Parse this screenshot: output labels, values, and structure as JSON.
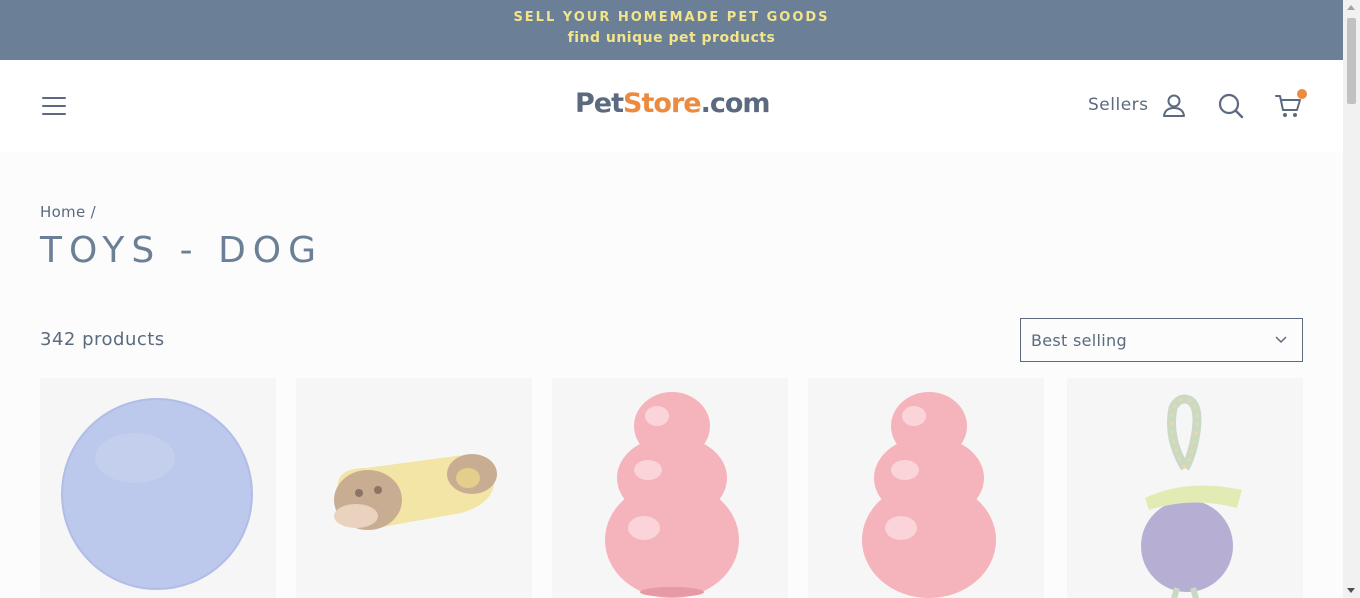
{
  "announcement": {
    "line1": "SELL YOUR HOMEMADE PET GOODS",
    "line2": "find unique pet products"
  },
  "header": {
    "logo_part1": "Pet",
    "logo_part2": "St",
    "logo_part3": "o",
    "logo_part4": "re",
    "logo_part5": ".com",
    "sellers_label": "Sellers",
    "icons": [
      "menu-icon",
      "user-icon",
      "search-icon",
      "cart-icon"
    ]
  },
  "breadcrumb": {
    "home": "Home",
    "separator": "/"
  },
  "page": {
    "title": "TOYS - DOG",
    "product_count": "342 products"
  },
  "sort": {
    "selected": "Best selling"
  },
  "products": [
    {
      "name": "blue-jolly-ball"
    },
    {
      "name": "monkey-plush-toy"
    },
    {
      "name": "red-kong-classic"
    },
    {
      "name": "red-kong-classic-2"
    },
    {
      "name": "purple-rope-ball"
    }
  ],
  "colors": {
    "announcement_bg": "#6b7f96",
    "announcement_text": "#f3e58a",
    "text": "#5b6a7e",
    "accent": "#ec8a3f"
  }
}
